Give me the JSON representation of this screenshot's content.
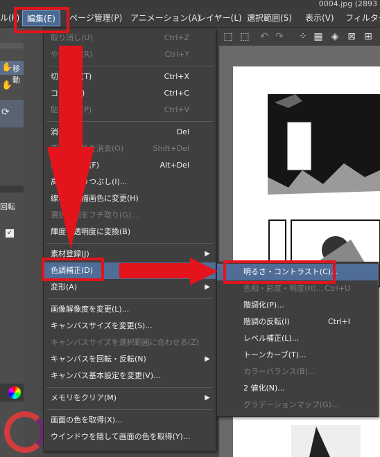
{
  "window": {
    "title": "0004.jpg (2893"
  },
  "menubar": {
    "items": [
      {
        "label": "ル(F)"
      },
      {
        "label": "編集(E)"
      },
      {
        "label": "ページ管理(P)"
      },
      {
        "label": "アニメーション(A)"
      },
      {
        "label": "レイヤー(L)"
      },
      {
        "label": "選択範囲(S)"
      },
      {
        "label": "表示(V)"
      },
      {
        "label": "フィルター(I"
      }
    ]
  },
  "left_panel": {
    "move_label": "移動",
    "rotate_label": "回転"
  },
  "edit_menu": {
    "items": [
      {
        "label": "取り消し(U)",
        "shortcut": "Ctrl+Z"
      },
      {
        "label": "やり直し(R)",
        "shortcut": "Ctrl+Y"
      },
      {
        "label": "切り取り(T)",
        "shortcut": "Ctrl+X"
      },
      {
        "label": "コピー(C)",
        "shortcut": "Ctrl+C"
      },
      {
        "label": "貼り付け(P)",
        "shortcut": "Ctrl+V"
      },
      {
        "label": "消去(E)",
        "shortcut": "Del"
      },
      {
        "label": "選択範囲外を消去(O)",
        "shortcut": "Shift+Del"
      },
      {
        "label": "塗りつぶし(F)",
        "shortcut": "Alt+Del"
      },
      {
        "label": "高度な塗りつぶし(I)...",
        "shortcut": ""
      },
      {
        "label": "線の色を描画色に変更(H)",
        "shortcut": ""
      },
      {
        "label": "選択範囲をフチ取り(G)...",
        "shortcut": ""
      },
      {
        "label": "輝度を透明度に変換(B)",
        "shortcut": ""
      },
      {
        "label": "素材登録(J)",
        "shortcut": ""
      },
      {
        "label": "色調補正(D)",
        "shortcut": ""
      },
      {
        "label": "変形(A)",
        "shortcut": ""
      },
      {
        "label": "画像解像度を変更(L)...",
        "shortcut": ""
      },
      {
        "label": "キャンバスサイズを変更(S)...",
        "shortcut": ""
      },
      {
        "label": "キャンバスサイズを選択範囲に合わせる(Z)",
        "shortcut": ""
      },
      {
        "label": "キャンバスを回転・反転(N)",
        "shortcut": ""
      },
      {
        "label": "キャンバス基本設定を変更(V)...",
        "shortcut": ""
      },
      {
        "label": "メモリをクリア(M)",
        "shortcut": ""
      },
      {
        "label": "画面の色を取得(X)...",
        "shortcut": ""
      },
      {
        "label": "ウインドウを隠して画面の色を取得(Y)...",
        "shortcut": ""
      }
    ]
  },
  "color_submenu": {
    "items": [
      {
        "label": "明るさ・コントラスト(C)...",
        "shortcut": ""
      },
      {
        "label": "色相・彩度・明度(H)...",
        "shortcut": "Ctrl+U"
      },
      {
        "label": "階調化(P)...",
        "shortcut": ""
      },
      {
        "label": "階調の反転(I)",
        "shortcut": "Ctrl+I"
      },
      {
        "label": "レベル補正(L)...",
        "shortcut": ""
      },
      {
        "label": "トーンカーブ(T)...",
        "shortcut": ""
      },
      {
        "label": "カラーバランス(B)...",
        "shortcut": ""
      },
      {
        "label": "2 値化(N)...",
        "shortcut": ""
      },
      {
        "label": "グラデーションマップ(G)...",
        "shortcut": ""
      }
    ]
  },
  "colors": {
    "highlight": "#4f6d96",
    "annotation_red": "#e3141b",
    "menu_bg": "#3f3f3f"
  }
}
